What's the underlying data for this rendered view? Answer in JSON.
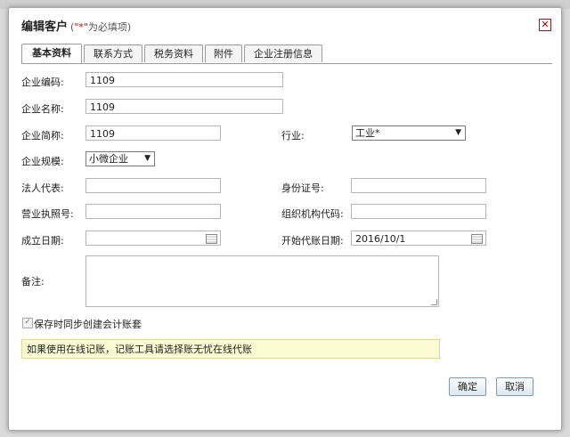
{
  "dialog": {
    "title": "编辑客户",
    "hint_prefix": "(",
    "hint_required": "\"*\"",
    "hint_suffix": "为必填项)",
    "close_glyph": "✕"
  },
  "tabs": [
    {
      "label": "基本资料",
      "active": true
    },
    {
      "label": "联系方式",
      "active": false
    },
    {
      "label": "税务资料",
      "active": false
    },
    {
      "label": "附件",
      "active": false
    },
    {
      "label": "企业注册信息",
      "active": false
    }
  ],
  "form": {
    "enterprise_code": {
      "label": "企业编码:",
      "value": "1109"
    },
    "enterprise_name": {
      "label": "企业名称:",
      "value": "1109"
    },
    "enterprise_short": {
      "label": "企业简称:",
      "value": "1109"
    },
    "industry": {
      "label": "行业:",
      "value": "工业*"
    },
    "enterprise_scale": {
      "label": "企业规模:",
      "value": "小微企业"
    },
    "legal_rep": {
      "label": "法人代表:",
      "value": ""
    },
    "id_number": {
      "label": "身份证号:",
      "value": ""
    },
    "business_license": {
      "label": "营业执照号:",
      "value": ""
    },
    "org_code": {
      "label": "组织机构代码:",
      "value": ""
    },
    "established_date": {
      "label": "成立日期:",
      "value": ""
    },
    "bookkeeping_start": {
      "label": "开始代账日期:",
      "value": "2016/10/1"
    },
    "remarks": {
      "label": "备注:",
      "value": ""
    }
  },
  "sync_checkbox": {
    "label": "保存时同步创建会计账套",
    "checked": true
  },
  "notice": "如果使用在线记账，记账工具请选择账无忧在线代账",
  "buttons": {
    "confirm": "确定",
    "cancel": "取消"
  },
  "icons": {
    "calendar": "calendar-icon",
    "dropdown": "chevron-down-icon",
    "close": "close-icon"
  },
  "colors": {
    "notice_bg": "#fdfbd2",
    "required": "#d00000",
    "close": "#b00000"
  }
}
